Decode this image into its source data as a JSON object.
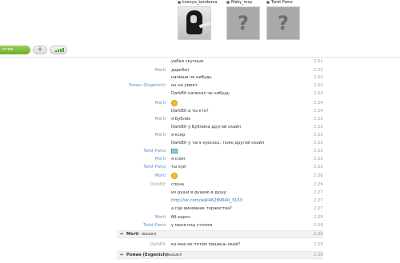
{
  "contacts": [
    {
      "name": "ksenya_korobova",
      "avatar": "photo"
    },
    {
      "name": "Maky_may",
      "avatar": "unknown"
    },
    {
      "name": "Twist Pwnz",
      "avatar": "unknown"
    }
  ],
  "toolbar": {
    "group_label": "ктов группо",
    "add_label": "+",
    "signal_icon": "signal-bars-icon"
  },
  "messages": [
    {
      "sender": "",
      "text": "уебки скучные",
      "time": "2:21"
    },
    {
      "sender": "Morti",
      "text": "даркбит",
      "time": "2:22"
    },
    {
      "sender": "",
      "text": "напиши че нибудь",
      "time": "2:22"
    },
    {
      "sender": "Роман (Evgenich)",
      "text": "он не умеет",
      "time": "2:22"
    },
    {
      "sender": "",
      "text": "DarkBit написал че нибудь",
      "time": "2:23"
    },
    {
      "sender": "Morti",
      "text": "",
      "emoji": "smile",
      "time": "2:24"
    },
    {
      "sender": "",
      "text": "DarkBit а ты кто?",
      "time": "2:24"
    },
    {
      "sender": "Morti",
      "text": "я Бублик",
      "time": "2:25"
    },
    {
      "sender": "",
      "text": "DarkBit у Бублика другой скайп",
      "time": "2:25"
    },
    {
      "sender": "Morti",
      "text": "я ксер",
      "time": "2:25"
    },
    {
      "sender": "",
      "text": "DarkBit у тагэ хуесось, тоже другой скайп",
      "time": "2:25"
    },
    {
      "sender": "Twist Pwnz",
      "text": "",
      "emoji": "image",
      "time": "2:25"
    },
    {
      "sender": "Morti",
      "text": "я слон",
      "time": "2:25"
    },
    {
      "sender": "Twist Pwnz",
      "text": "ты хуй",
      "time": "2:25"
    },
    {
      "sender": "Morti",
      "text": "",
      "emoji": "smile",
      "time": "2:26"
    },
    {
      "sender": "DarkBit",
      "text": "слона",
      "time": "2:26"
    },
    {
      "sender": "",
      "text": "из души в душею в душу",
      "time": "2:27"
    },
    {
      "sender": "",
      "text": "http://vk.com/wall46289640_3153",
      "time": "2:27",
      "link": true
    },
    {
      "sender": "",
      "text": "а где виновник торжества?",
      "time": "2:27"
    },
    {
      "sender": "Morti",
      "text": "бб кароч",
      "time": "2:29"
    },
    {
      "sender": "Twist Pwnz",
      "text": "у меня под столом",
      "time": "2:29"
    }
  ],
  "system_events": [
    {
      "who": "Morti",
      "action": "вышел",
      "time": "2:29"
    },
    {
      "who": "Роман (Evgenich)",
      "action": "вышел",
      "time": "2:29"
    }
  ],
  "after_first_event": {
    "sender": "DarkBit",
    "text": "ко мне ее потом пишешь окей?",
    "time": "2:29"
  }
}
